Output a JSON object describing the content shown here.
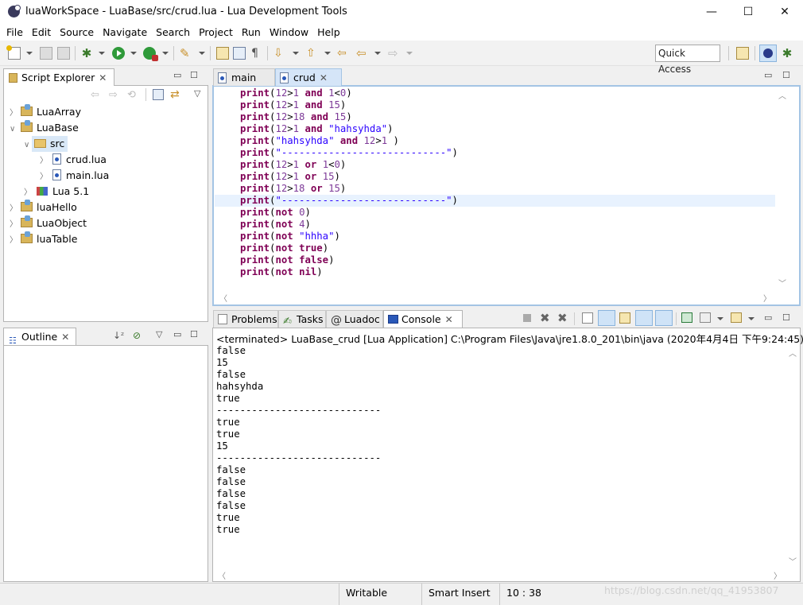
{
  "window": {
    "title": "luaWorkSpace - LuaBase/src/crud.lua - Lua Development Tools",
    "minimize": "—",
    "maximize": "☐",
    "close": "✕"
  },
  "menu": [
    "File",
    "Edit",
    "Source",
    "Navigate",
    "Search",
    "Project",
    "Run",
    "Window",
    "Help"
  ],
  "toolbar": {
    "quick_access": "Quick Access",
    "icons": [
      "new-icon",
      "save-icon",
      "save-all-icon",
      "debug-icon",
      "run-icon",
      "external-tools-icon",
      "build-icon",
      "open-type-icon",
      "open-resource-icon",
      "pilcrow-icon",
      "next-annotation-icon",
      "prev-annotation-icon",
      "last-edit-icon",
      "back-icon",
      "forward-icon"
    ]
  },
  "script_explorer": {
    "title": "Script Explorer",
    "tree": [
      {
        "label": "LuaArray",
        "type": "project",
        "expanded": false
      },
      {
        "label": "LuaBase",
        "type": "project",
        "expanded": true
      },
      {
        "label": "src",
        "type": "folder",
        "expanded": true,
        "selected": true
      },
      {
        "label": "crud.lua",
        "type": "file"
      },
      {
        "label": "main.lua",
        "type": "file"
      },
      {
        "label": "Lua 5.1",
        "type": "library"
      },
      {
        "label": "luaHello",
        "type": "project"
      },
      {
        "label": "LuaObject",
        "type": "project"
      },
      {
        "label": "luaTable",
        "type": "project"
      }
    ]
  },
  "outline": {
    "title": "Outline"
  },
  "editor": {
    "tabs": [
      {
        "label": "main",
        "active": false
      },
      {
        "label": "crud",
        "active": true
      }
    ],
    "current_line_index": 9,
    "lines": [
      [
        {
          "t": "print",
          "c": "kw"
        },
        {
          "t": "(",
          "c": ""
        },
        {
          "t": "12",
          "c": "num"
        },
        {
          "t": ">",
          "c": ""
        },
        {
          "t": "1",
          "c": "num"
        },
        {
          "t": " ",
          "c": ""
        },
        {
          "t": "and",
          "c": "kw"
        },
        {
          "t": " ",
          "c": ""
        },
        {
          "t": "1",
          "c": "num"
        },
        {
          "t": "<",
          "c": ""
        },
        {
          "t": "0",
          "c": "num"
        },
        {
          "t": ")",
          "c": ""
        }
      ],
      [
        {
          "t": "print",
          "c": "kw"
        },
        {
          "t": "(",
          "c": ""
        },
        {
          "t": "12",
          "c": "num"
        },
        {
          "t": ">",
          "c": ""
        },
        {
          "t": "1",
          "c": "num"
        },
        {
          "t": " ",
          "c": ""
        },
        {
          "t": "and",
          "c": "kw"
        },
        {
          "t": " ",
          "c": ""
        },
        {
          "t": "15",
          "c": "num"
        },
        {
          "t": ")",
          "c": ""
        }
      ],
      [
        {
          "t": "print",
          "c": "kw"
        },
        {
          "t": "(",
          "c": ""
        },
        {
          "t": "12",
          "c": "num"
        },
        {
          "t": ">",
          "c": ""
        },
        {
          "t": "18",
          "c": "num"
        },
        {
          "t": " ",
          "c": ""
        },
        {
          "t": "and",
          "c": "kw"
        },
        {
          "t": " ",
          "c": ""
        },
        {
          "t": "15",
          "c": "num"
        },
        {
          "t": ")",
          "c": ""
        }
      ],
      [
        {
          "t": "print",
          "c": "kw"
        },
        {
          "t": "(",
          "c": ""
        },
        {
          "t": "12",
          "c": "num"
        },
        {
          "t": ">",
          "c": ""
        },
        {
          "t": "1",
          "c": "num"
        },
        {
          "t": " ",
          "c": ""
        },
        {
          "t": "and",
          "c": "kw"
        },
        {
          "t": " ",
          "c": ""
        },
        {
          "t": "\"hahsyhda\"",
          "c": "str"
        },
        {
          "t": ")",
          "c": ""
        }
      ],
      [
        {
          "t": "print",
          "c": "kw"
        },
        {
          "t": "(",
          "c": ""
        },
        {
          "t": "\"hahsyhda\"",
          "c": "str"
        },
        {
          "t": " ",
          "c": ""
        },
        {
          "t": "and",
          "c": "kw"
        },
        {
          "t": " ",
          "c": ""
        },
        {
          "t": "12",
          "c": "num"
        },
        {
          "t": ">",
          "c": ""
        },
        {
          "t": "1",
          "c": "num"
        },
        {
          "t": " )",
          "c": ""
        }
      ],
      [
        {
          "t": "print",
          "c": "kw"
        },
        {
          "t": "(",
          "c": ""
        },
        {
          "t": "\"----------------------------\"",
          "c": "str"
        },
        {
          "t": ")",
          "c": ""
        }
      ],
      [
        {
          "t": "print",
          "c": "kw"
        },
        {
          "t": "(",
          "c": ""
        },
        {
          "t": "12",
          "c": "num"
        },
        {
          "t": ">",
          "c": ""
        },
        {
          "t": "1",
          "c": "num"
        },
        {
          "t": " ",
          "c": ""
        },
        {
          "t": "or",
          "c": "kw"
        },
        {
          "t": " ",
          "c": ""
        },
        {
          "t": "1",
          "c": "num"
        },
        {
          "t": "<",
          "c": ""
        },
        {
          "t": "0",
          "c": "num"
        },
        {
          "t": ")",
          "c": ""
        }
      ],
      [
        {
          "t": "print",
          "c": "kw"
        },
        {
          "t": "(",
          "c": ""
        },
        {
          "t": "12",
          "c": "num"
        },
        {
          "t": ">",
          "c": ""
        },
        {
          "t": "1",
          "c": "num"
        },
        {
          "t": " ",
          "c": ""
        },
        {
          "t": "or",
          "c": "kw"
        },
        {
          "t": " ",
          "c": ""
        },
        {
          "t": "15",
          "c": "num"
        },
        {
          "t": ")",
          "c": ""
        }
      ],
      [
        {
          "t": "print",
          "c": "kw"
        },
        {
          "t": "(",
          "c": ""
        },
        {
          "t": "12",
          "c": "num"
        },
        {
          "t": ">",
          "c": ""
        },
        {
          "t": "18",
          "c": "num"
        },
        {
          "t": " ",
          "c": ""
        },
        {
          "t": "or",
          "c": "kw"
        },
        {
          "t": " ",
          "c": ""
        },
        {
          "t": "15",
          "c": "num"
        },
        {
          "t": ")",
          "c": ""
        }
      ],
      [
        {
          "t": "print",
          "c": "kw"
        },
        {
          "t": "(",
          "c": ""
        },
        {
          "t": "\"----------------------------\"",
          "c": "str"
        },
        {
          "t": ")",
          "c": ""
        }
      ],
      [
        {
          "t": "print",
          "c": "kw"
        },
        {
          "t": "(",
          "c": ""
        },
        {
          "t": "not",
          "c": "kw"
        },
        {
          "t": " ",
          "c": ""
        },
        {
          "t": "0",
          "c": "num"
        },
        {
          "t": ")",
          "c": ""
        }
      ],
      [
        {
          "t": "print",
          "c": "kw"
        },
        {
          "t": "(",
          "c": ""
        },
        {
          "t": "not",
          "c": "kw"
        },
        {
          "t": " ",
          "c": ""
        },
        {
          "t": "4",
          "c": "num"
        },
        {
          "t": ")",
          "c": ""
        }
      ],
      [
        {
          "t": "print",
          "c": "kw"
        },
        {
          "t": "(",
          "c": ""
        },
        {
          "t": "not",
          "c": "kw"
        },
        {
          "t": " ",
          "c": ""
        },
        {
          "t": "\"hhha\"",
          "c": "str"
        },
        {
          "t": ")",
          "c": ""
        }
      ],
      [
        {
          "t": "print",
          "c": "kw"
        },
        {
          "t": "(",
          "c": ""
        },
        {
          "t": "not",
          "c": "kw"
        },
        {
          "t": " ",
          "c": ""
        },
        {
          "t": "true",
          "c": "kw"
        },
        {
          "t": ")",
          "c": ""
        }
      ],
      [
        {
          "t": "print",
          "c": "kw"
        },
        {
          "t": "(",
          "c": ""
        },
        {
          "t": "not",
          "c": "kw"
        },
        {
          "t": " ",
          "c": ""
        },
        {
          "t": "false",
          "c": "kw"
        },
        {
          "t": ")",
          "c": ""
        }
      ],
      [
        {
          "t": "print",
          "c": "kw"
        },
        {
          "t": "(",
          "c": ""
        },
        {
          "t": "not",
          "c": "kw"
        },
        {
          "t": " ",
          "c": ""
        },
        {
          "t": "nil",
          "c": "kw"
        },
        {
          "t": ")",
          "c": ""
        }
      ]
    ]
  },
  "bottom_panel": {
    "tabs": [
      {
        "label": "Problems",
        "active": false
      },
      {
        "label": "Tasks",
        "active": false
      },
      {
        "label": "Luadoc",
        "active": false
      },
      {
        "label": "Console",
        "active": true
      }
    ],
    "console_header": "<terminated> LuaBase_crud [Lua Application] C:\\Program Files\\Java\\jre1.8.0_201\\bin\\java (2020年4月4日 下午9:24:45)",
    "output": [
      "false",
      "15",
      "false",
      "hahsyhda",
      "true",
      "----------------------------",
      "true",
      "true",
      "15",
      "----------------------------",
      "false",
      "false",
      "false",
      "false",
      "true",
      "true"
    ]
  },
  "status_bar": {
    "writable": "Writable",
    "insert_mode": "Smart Insert",
    "position": "10 : 38",
    "watermark": "https://blog.csdn.net/qq_41953807"
  },
  "colors": {
    "keyword": "#7f0055",
    "number": "#7d3a98",
    "string": "#2a00ff",
    "current_line": "#e8f2fe"
  }
}
